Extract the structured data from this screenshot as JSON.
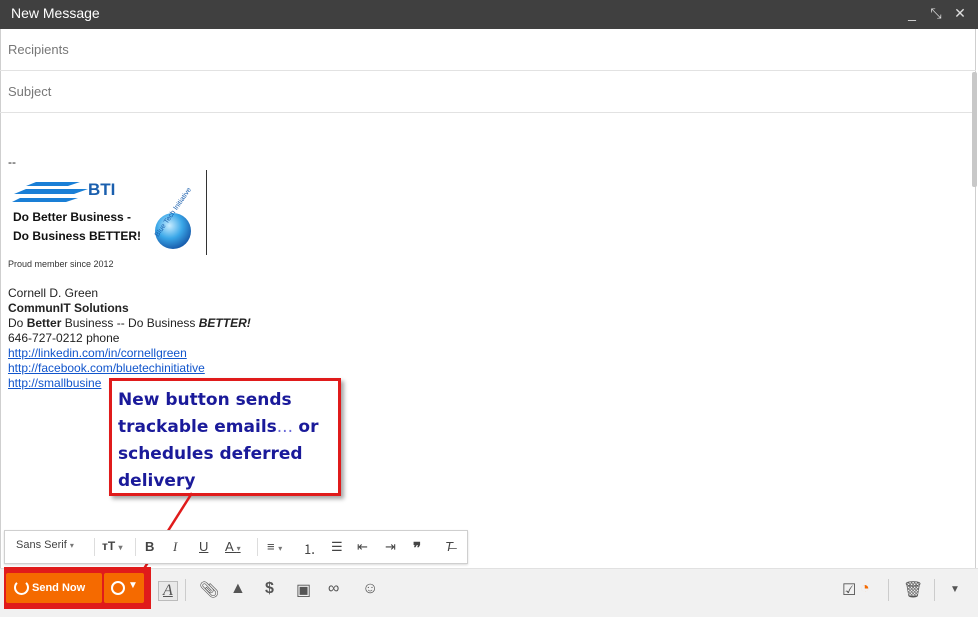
{
  "window": {
    "title": "New Message",
    "minimize_icon": "minimize-icon",
    "popout_icon": "popout-icon",
    "close_icon": "close-icon",
    "minimize_glyph": "_",
    "popout_glyph": "⤡",
    "close_glyph": "✕"
  },
  "fields": {
    "recipients_placeholder": "Recipients",
    "subject_placeholder": "Subject"
  },
  "body": {
    "sig_separator": "--",
    "logo": {
      "brand": "BTI",
      "line1": "Do Better Business -",
      "line2": "Do Business BETTER!",
      "circle_text": "Blue Tech Initiative"
    },
    "proud": "Proud member since 2012",
    "contact": {
      "name": "Cornell D. Green",
      "company": "CommunIT Solutions",
      "tagline_a": "Do ",
      "tagline_b": "Better",
      "tagline_c": " Business -- Do Business ",
      "tagline_d": "BETTER!",
      "phone": "646-727-0212 phone",
      "link1": "http://linkedin.com/in/cornellgreen",
      "link2": "http://facebook.com/bluetechinitiative",
      "link3": "http://smallbusine"
    }
  },
  "callout": {
    "line1": "New button sends",
    "line2a": "trackable emails",
    "line2b": "... ",
    "line2c": "or",
    "line3": "schedules deferred",
    "line4": "delivery"
  },
  "format_toolbar": {
    "font": "Sans Serif",
    "size_icon": "text-size-icon",
    "bold": "B",
    "italic": "I",
    "underline": "U",
    "text_color": "A",
    "align_icon": "align-icon",
    "numbered_list_icon": "numbered-list-icon",
    "bulleted_list_icon": "bulleted-list-icon",
    "indent_less_icon": "indent-less-icon",
    "indent_more_icon": "indent-more-icon",
    "quote_icon": "quote-icon",
    "clear_format_icon": "clear-format-icon"
  },
  "bottom_toolbar": {
    "send_label": "Send Now",
    "schedule_icon": "clock-icon",
    "formatting": "A",
    "attach_icon": "paperclip-icon",
    "drive_icon": "drive-icon",
    "money_icon": "dollar-icon",
    "photo_icon": "photo-icon",
    "link_icon": "link-icon",
    "emoji_icon": "smiley-icon",
    "tracking_icon": "tracking-check-icon",
    "trash_icon": "trash-icon",
    "more_icon": "caret-down-icon"
  },
  "colors": {
    "titlebar": "#404040",
    "send": "#f56a00",
    "callout_border": "#e01b1b",
    "callout_text": "#1a1a9a",
    "link": "#1155cc"
  }
}
